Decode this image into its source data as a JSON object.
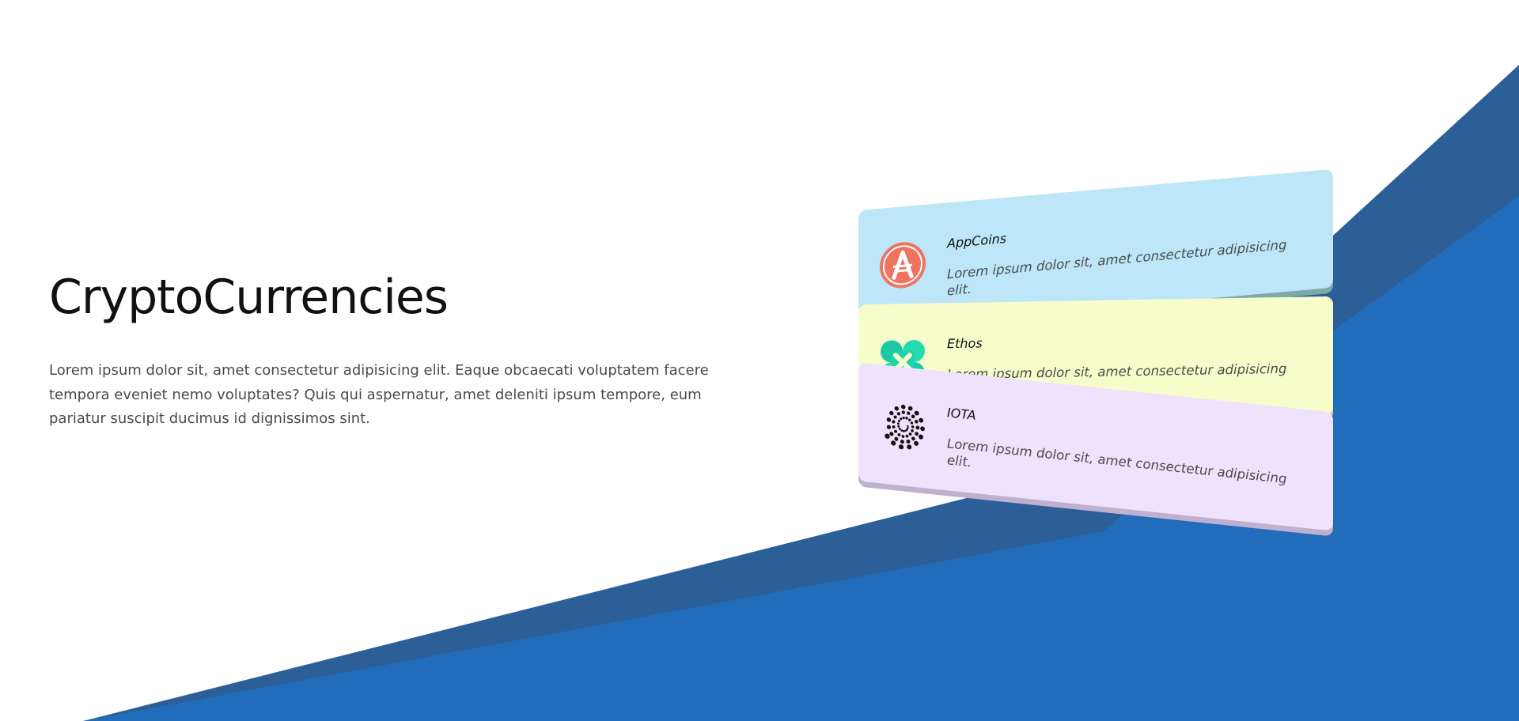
{
  "hero": {
    "title": "CryptoCurrencies",
    "description": "Lorem ipsum dolor sit, amet consectetur adipisicing elit. Eaque obcaecati voluptatem facere tempora eveniet nemo voluptates? Quis qui aspernatur, amet deleniti ipsum tempore, eum pariatur suscipit ducimus id dignissimos sint."
  },
  "cards": [
    {
      "name": "AppCoins",
      "description": "Lorem ipsum dolor sit, amet consectetur adipisicing elit.",
      "icon": "appcoins-logo-icon",
      "color": "#bde6f9"
    },
    {
      "name": "Ethos",
      "description": "Lorem ipsum dolor sit, amet consectetur adipisicing elit.",
      "icon": "ethos-logo-icon",
      "color": "#f6fdca"
    },
    {
      "name": "IOTA",
      "description": "Lorem ipsum dolor sit, amet consectetur adipisicing elit.",
      "icon": "iota-logo-icon",
      "color": "#eee2fc"
    }
  ],
  "colors": {
    "background": "#ffffff",
    "blue_primary": "#226dbb",
    "blue_dark": "#2c5f98"
  }
}
